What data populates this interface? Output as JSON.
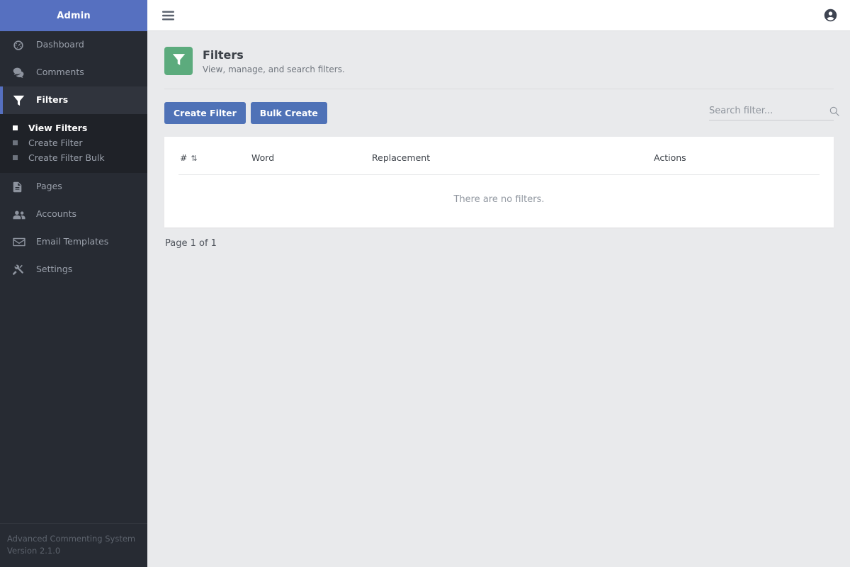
{
  "sidebar": {
    "brand": "Admin",
    "items": [
      {
        "label": "Dashboard",
        "icon": "gauge-icon"
      },
      {
        "label": "Comments",
        "icon": "comments-icon"
      },
      {
        "label": "Filters",
        "icon": "funnel-icon"
      },
      {
        "label": "Pages",
        "icon": "file-icon"
      },
      {
        "label": "Accounts",
        "icon": "users-icon"
      },
      {
        "label": "Email Templates",
        "icon": "envelope-icon"
      },
      {
        "label": "Settings",
        "icon": "tools-icon"
      }
    ],
    "submenu": [
      {
        "label": "View Filters"
      },
      {
        "label": "Create Filter"
      },
      {
        "label": "Create Filter Bulk"
      }
    ],
    "footer": {
      "app_name": "Advanced Commenting System",
      "version": "Version 2.1.0"
    },
    "accent_color": "#5670c0"
  },
  "topbar": {
    "menu_icon": "hamburger-icon",
    "account_icon": "account-circle-icon"
  },
  "page": {
    "title": "Filters",
    "subtitle": "View, manage, and search filters.",
    "icon": "funnel-icon",
    "icon_color": "#5cab7d"
  },
  "toolbar": {
    "create_label": "Create Filter",
    "bulk_create_label": "Bulk Create",
    "button_color": "#4f72b7",
    "search": {
      "value": "",
      "placeholder": "Search filter...",
      "icon": "search-icon"
    }
  },
  "table": {
    "columns": [
      "#",
      "Word",
      "Replacement",
      "Actions"
    ],
    "sort_indicator": "⇅",
    "rows": [],
    "empty_message": "There are no filters."
  },
  "pagination": {
    "label": "Page 1 of 1"
  }
}
